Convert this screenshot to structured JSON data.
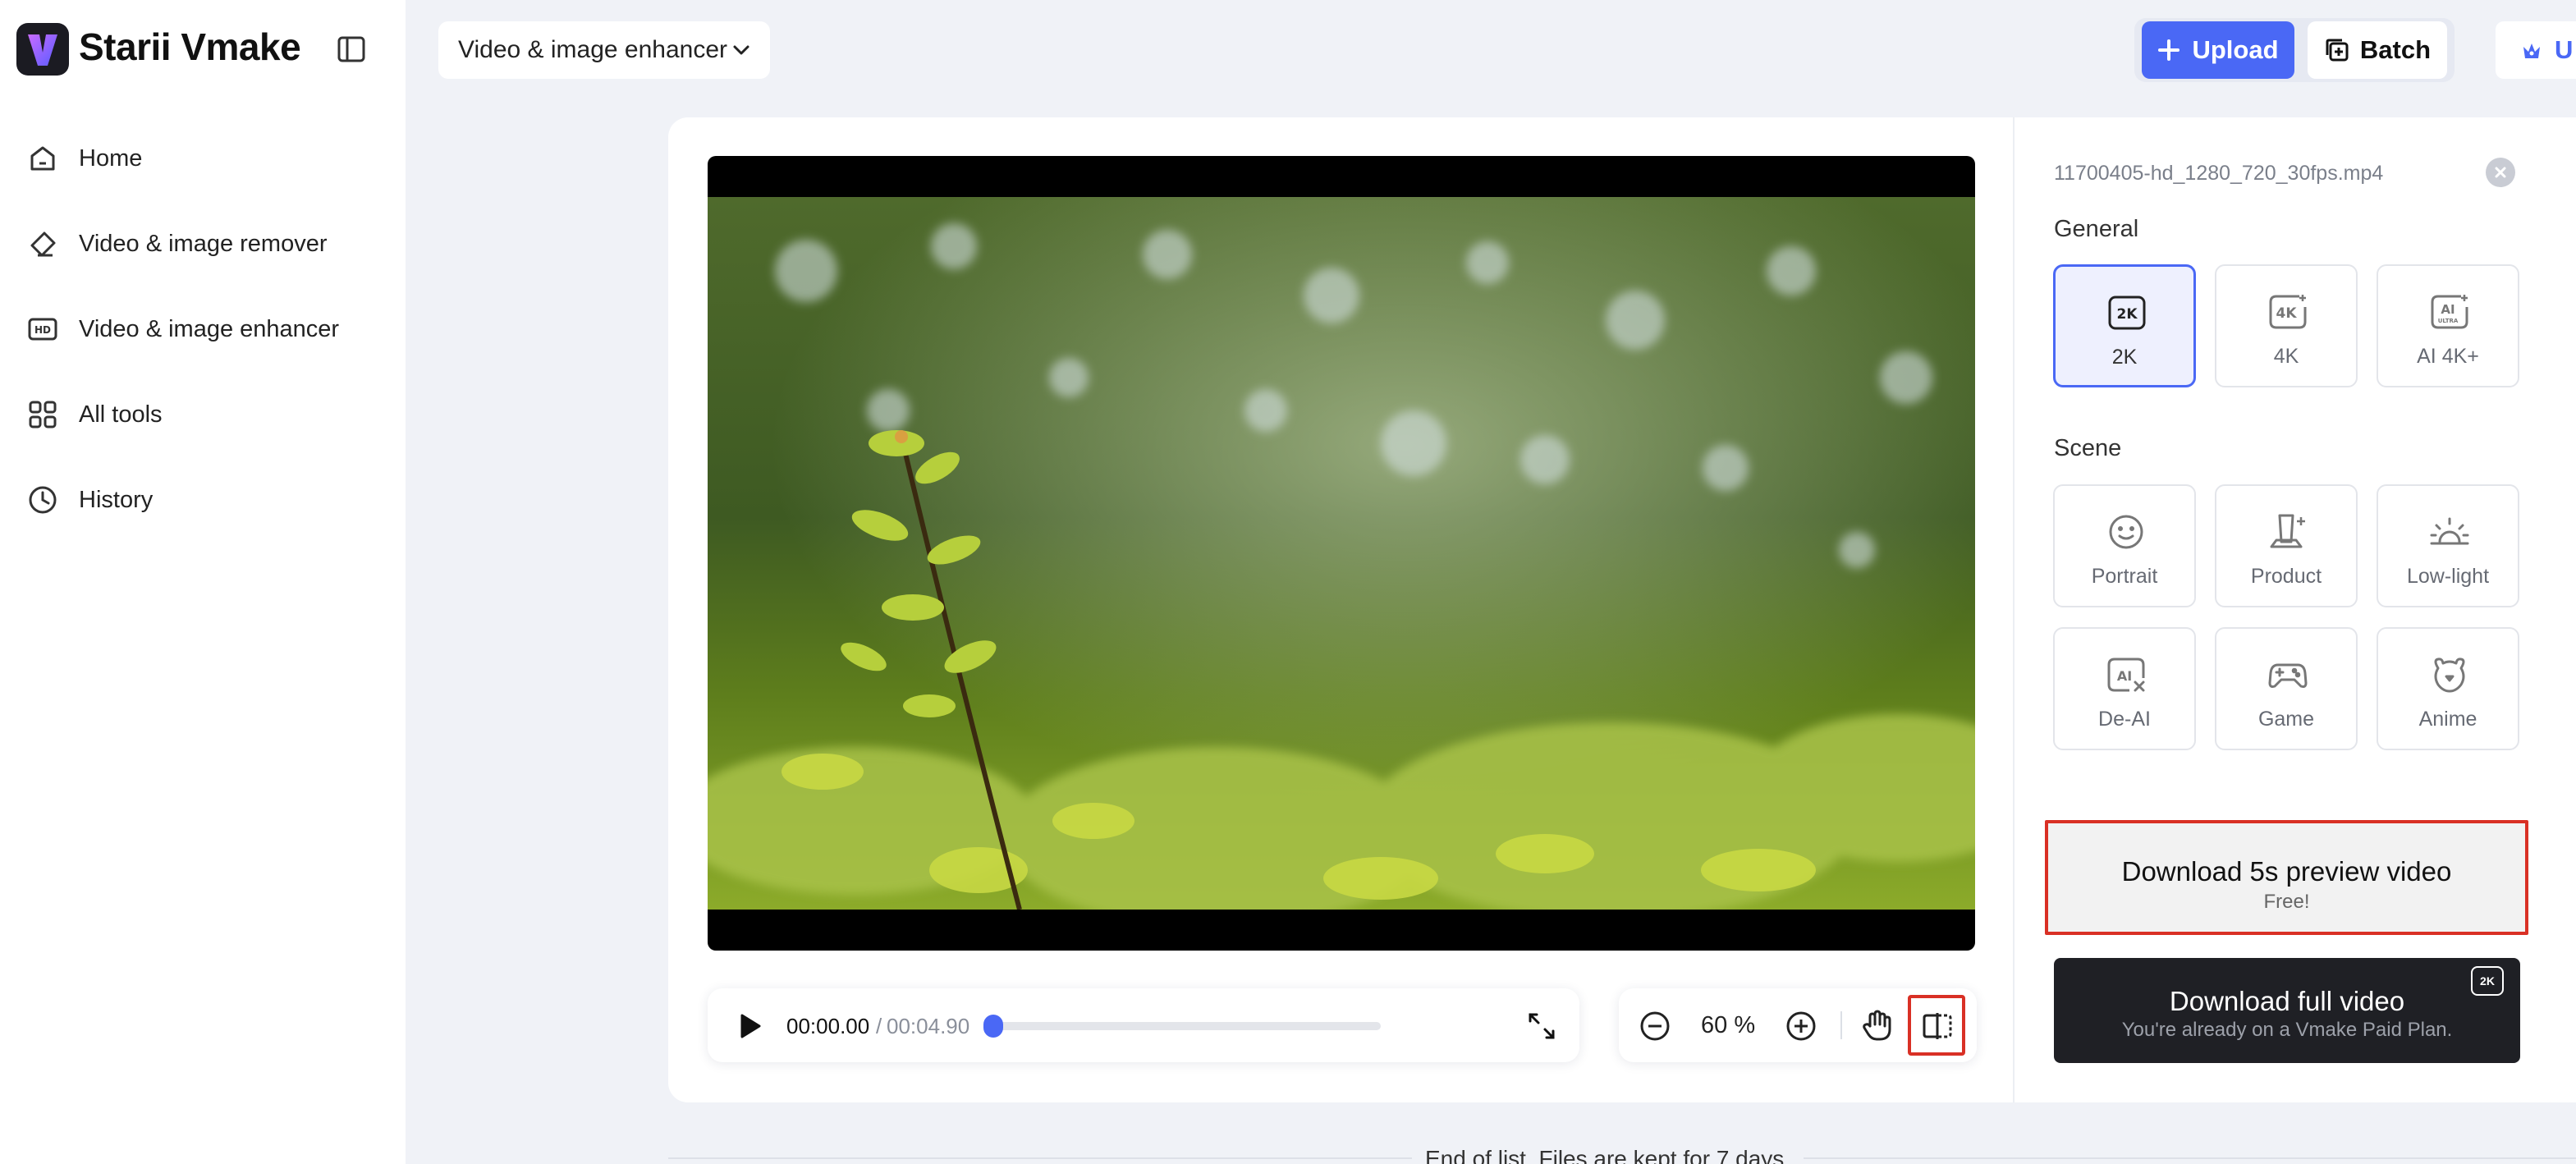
{
  "app": {
    "name": "Starii Vmake",
    "brand_color": "#4a68f5"
  },
  "sidebar": {
    "items": [
      {
        "label": "Home",
        "icon": "home-icon"
      },
      {
        "label": "Video & image remover",
        "icon": "eraser-icon"
      },
      {
        "label": "Video & image enhancer",
        "icon": "hd-icon"
      },
      {
        "label": "All tools",
        "icon": "grid-icon"
      },
      {
        "label": "History",
        "icon": "clock-icon"
      }
    ]
  },
  "topbar": {
    "mode_label": "Video & image enhancer",
    "upload_label": "Upload",
    "batch_label": "Batch",
    "upgrade_label": "U"
  },
  "player": {
    "current_time": "00:00.00",
    "separator": " / ",
    "total_time": "00:04.90",
    "progress": 0.0
  },
  "zoom": {
    "value": "60 %"
  },
  "panel": {
    "file_name": "11700405-hd_1280_720_30fps.mp4",
    "general_title": "General",
    "general_options": [
      {
        "label": "2K",
        "icon": "2k-icon",
        "selected": true
      },
      {
        "label": "4K",
        "icon": "4k-icon",
        "selected": false
      },
      {
        "label": "AI 4K+",
        "icon": "ai-ultra-icon",
        "selected": false
      }
    ],
    "scene_title": "Scene",
    "scene_options": [
      {
        "label": "Portrait",
        "icon": "smiley-icon"
      },
      {
        "label": "Product",
        "icon": "product-icon"
      },
      {
        "label": "Low-light",
        "icon": "sunrise-icon"
      },
      {
        "label": "De-AI",
        "icon": "de-ai-icon"
      },
      {
        "label": "Game",
        "icon": "gamepad-icon"
      },
      {
        "label": "Anime",
        "icon": "bear-icon"
      }
    ],
    "preview_button": {
      "title": "Download 5s preview video",
      "subtitle": "Free!"
    },
    "full_button": {
      "title": "Download full video",
      "subtitle": "You're already on a Vmake Paid Plan.",
      "badge": "2K"
    }
  },
  "footer": {
    "text": "End of list. Files are kept for 7 days."
  }
}
